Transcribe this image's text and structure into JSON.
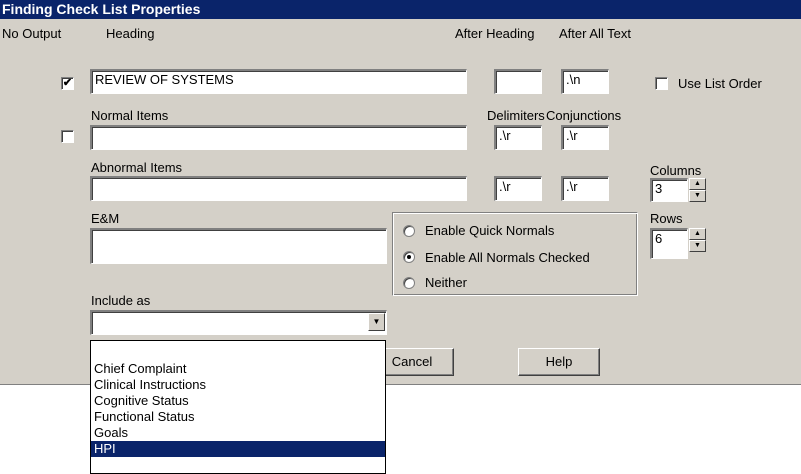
{
  "title": "Finding Check List Properties",
  "labels": {
    "no_output": "No Output",
    "heading": "Heading",
    "after_heading": "After Heading",
    "after_all_text": "After All Text",
    "normal_items": "Normal Items",
    "delimiters": "Delimiters",
    "conjunctions": "Conjunctions",
    "abnormal_items": "Abnormal Items",
    "columns": "Columns",
    "rows": "Rows",
    "em": "E&M",
    "include_as": "Include as",
    "use_list_order": "Use List Order"
  },
  "fields": {
    "heading_value": "REVIEW OF SYSTEMS",
    "after_heading_value": "",
    "after_all_text_value": ".\\n",
    "normal_items_value": "",
    "normal_delimiter": ".\\r",
    "normal_conjunction": ".\\r",
    "abnormal_items_value": "",
    "abnormal_delimiter": ".\\r",
    "abnormal_conjunction": ".\\r",
    "columns_value": "3",
    "rows_value": "6",
    "em_value": "",
    "include_as_value": ""
  },
  "checkboxes": {
    "no_output_heading": true,
    "no_output_normal": false,
    "use_list_order": false
  },
  "radios": [
    {
      "label": "Enable Quick Normals",
      "selected": false
    },
    {
      "label": "Enable All Normals Checked",
      "selected": true
    },
    {
      "label": "Neither",
      "selected": false
    }
  ],
  "buttons": {
    "cancel": "Cancel",
    "help": "Help"
  },
  "dropdown_items": [
    {
      "label": "Chief Complaint",
      "selected": false
    },
    {
      "label": "Clinical Instructions",
      "selected": false
    },
    {
      "label": "Cognitive Status",
      "selected": false
    },
    {
      "label": "Functional Status",
      "selected": false
    },
    {
      "label": "Goals",
      "selected": false
    },
    {
      "label": "HPI",
      "selected": true
    }
  ],
  "colors": {
    "title_bar": "#0a246a",
    "dialog_face": "#d4d0c8",
    "selection": "#0a246a"
  }
}
